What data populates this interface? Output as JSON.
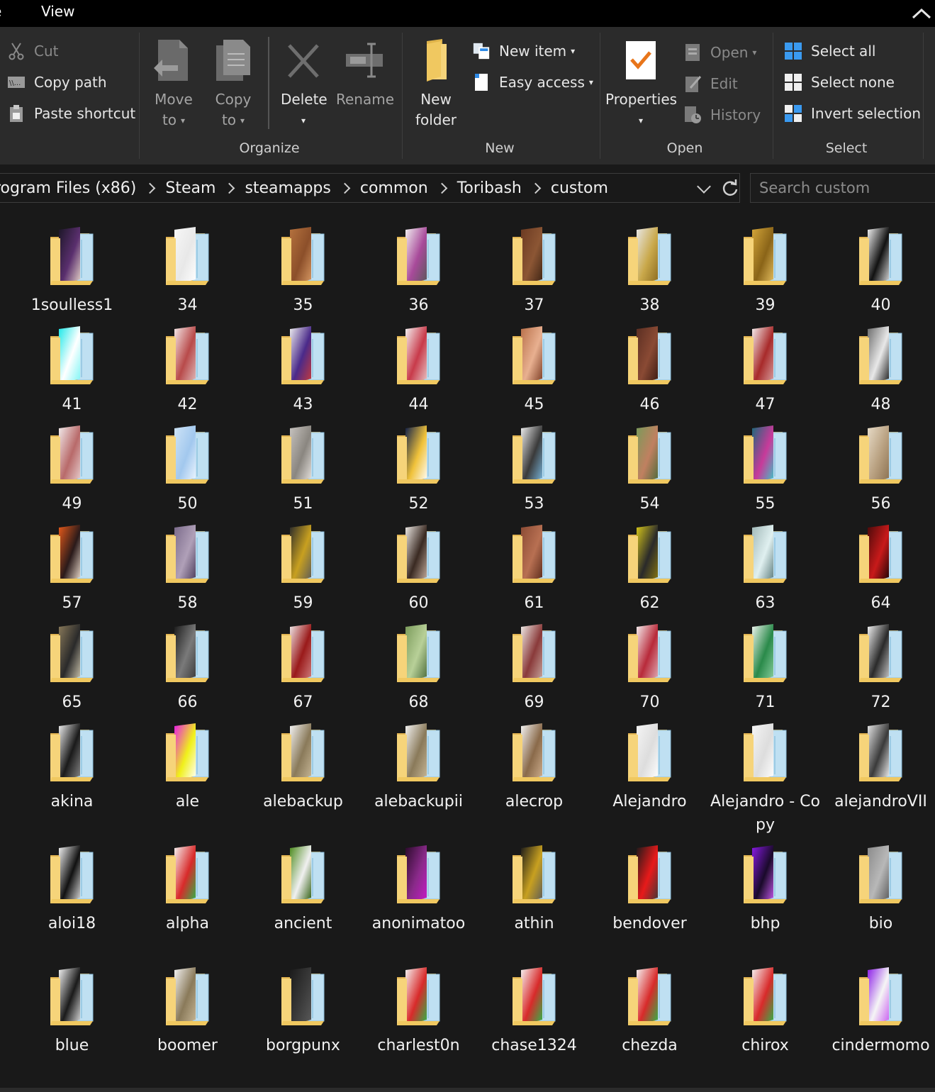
{
  "tabs": {
    "file": "e",
    "view": "View"
  },
  "ribbon": {
    "clipboard": {
      "cut": "Cut",
      "copy_path": "Copy path",
      "paste_shortcut": "Paste shortcut"
    },
    "organize": {
      "title": "Organize",
      "move_to_1": "Move",
      "move_to_2": "to",
      "copy_to_1": "Copy",
      "copy_to_2": "to",
      "delete": "Delete",
      "rename": "Rename"
    },
    "new": {
      "title": "New",
      "new_folder_1": "New",
      "new_folder_2": "folder",
      "new_item": "New item",
      "easy_access": "Easy access"
    },
    "open": {
      "title": "Open",
      "properties": "Properties",
      "open": "Open",
      "edit": "Edit",
      "history": "History"
    },
    "select": {
      "title": "Select",
      "select_all": "Select all",
      "select_none": "Select none",
      "invert_selection": "Invert selection"
    }
  },
  "address": {
    "breadcrumbs": [
      "rogram Files (x86)",
      "Steam",
      "steamapps",
      "common",
      "Toribash",
      "custom"
    ]
  },
  "search": {
    "placeholder": "Search custom"
  },
  "folders": [
    {
      "name": "1soulless1",
      "thumb": [
        "#1b1626",
        "#5a2f6e",
        "#e7d4c8"
      ]
    },
    {
      "name": "34",
      "thumb": [
        "#f7f7f7",
        "#e8e8e8",
        "#ffffff"
      ]
    },
    {
      "name": "35",
      "thumb": [
        "#b5723e",
        "#8c4f2a",
        "#d89a64"
      ]
    },
    {
      "name": "36",
      "thumb": [
        "#f2f2f2",
        "#a84a9a",
        "#5a5a5a"
      ]
    },
    {
      "name": "37",
      "thumb": [
        "#6b3a22",
        "#8c5634",
        "#3d2314"
      ]
    },
    {
      "name": "38",
      "thumb": [
        "#e8e8e8",
        "#c9a84a",
        "#8a6a1e"
      ]
    },
    {
      "name": "39",
      "thumb": [
        "#d4a63a",
        "#8a6418",
        "#e6c060"
      ]
    },
    {
      "name": "40",
      "thumb": [
        "#f5f5f5",
        "#111111",
        "#dddddd"
      ]
    },
    {
      "name": "41",
      "thumb": [
        "#19e8e8",
        "#ffffff",
        "#7af5f5"
      ]
    },
    {
      "name": "42",
      "thumb": [
        "#f5eaea",
        "#b84a4a",
        "#e0bcbc"
      ]
    },
    {
      "name": "43",
      "thumb": [
        "#f0f0f0",
        "#4a2a8a",
        "#c83a3a"
      ]
    },
    {
      "name": "44",
      "thumb": [
        "#f5f5f5",
        "#c83a4a",
        "#e8c8c8"
      ]
    },
    {
      "name": "45",
      "thumb": [
        "#b8704a",
        "#e8b090",
        "#7a3a22"
      ]
    },
    {
      "name": "46",
      "thumb": [
        "#5a2e22",
        "#8a4a34",
        "#3a1a12"
      ]
    },
    {
      "name": "47",
      "thumb": [
        "#f5f0f0",
        "#a82a2a",
        "#d8a0a0"
      ]
    },
    {
      "name": "48",
      "thumb": [
        "#6a6a6a",
        "#e8e8e8",
        "#1a1a1a"
      ]
    },
    {
      "name": "49",
      "thumb": [
        "#f2ecec",
        "#b86a6a",
        "#e8d0d0"
      ]
    },
    {
      "name": "50",
      "thumb": [
        "#cfe4f7",
        "#a2c8ee",
        "#f0f7ff"
      ]
    },
    {
      "name": "51",
      "thumb": [
        "#c8c4c0",
        "#8a8680",
        "#e8e4e0"
      ]
    },
    {
      "name": "52",
      "thumb": [
        "#0e1e4a",
        "#f0c23a",
        "#ffffff"
      ]
    },
    {
      "name": "53",
      "thumb": [
        "#f0f0f0",
        "#3a3a3a",
        "#7ab8e0"
      ]
    },
    {
      "name": "54",
      "thumb": [
        "#7a9a5a",
        "#c08060",
        "#4a6a3a"
      ]
    },
    {
      "name": "55",
      "thumb": [
        "#1a6a7a",
        "#c83a9a",
        "#3ac8c8"
      ]
    },
    {
      "name": "56",
      "thumb": [
        "#e8dcc8",
        "#b8a080",
        "#8a7050"
      ]
    },
    {
      "name": "57",
      "thumb": [
        "#e85a1a",
        "#2a1a1a",
        "#f0e0d0"
      ]
    },
    {
      "name": "58",
      "thumb": [
        "#7a6a8a",
        "#b0a0b8",
        "#4a3a5a"
      ]
    },
    {
      "name": "59",
      "thumb": [
        "#2a2a2a",
        "#c8a020",
        "#5a5a5a"
      ]
    },
    {
      "name": "60",
      "thumb": [
        "#f0ece8",
        "#3a2a22",
        "#c8b0a0"
      ]
    },
    {
      "name": "61",
      "thumb": [
        "#8a4a34",
        "#b87052",
        "#5a2a1a"
      ]
    },
    {
      "name": "62",
      "thumb": [
        "#d8c81a",
        "#2a2a2a",
        "#8a7a10"
      ]
    },
    {
      "name": "63",
      "thumb": [
        "#a0b8b8",
        "#e0f0f0",
        "#5a7a7a"
      ]
    },
    {
      "name": "64",
      "thumb": [
        "#4a0a0a",
        "#c81a1a",
        "#1a0404"
      ]
    },
    {
      "name": "65",
      "thumb": [
        "#8a7a5a",
        "#2a2a2a",
        "#d0c8b0"
      ]
    },
    {
      "name": "66",
      "thumb": [
        "#1a1a1a",
        "#7a7a7a",
        "#3a3a3a"
      ]
    },
    {
      "name": "67",
      "thumb": [
        "#f0e8e8",
        "#9a1a1a",
        "#d08080"
      ]
    },
    {
      "name": "68",
      "thumb": [
        "#7a9a5a",
        "#b8d098",
        "#4a6a3a"
      ]
    },
    {
      "name": "69",
      "thumb": [
        "#f0ece8",
        "#8a3a3a",
        "#c8a8a0"
      ]
    },
    {
      "name": "70",
      "thumb": [
        "#f5f0f0",
        "#b82a3a",
        "#e0b0b8"
      ]
    },
    {
      "name": "71",
      "thumb": [
        "#f0f5f0",
        "#2a8a4a",
        "#8ad0a0"
      ]
    },
    {
      "name": "72",
      "thumb": [
        "#f5f5f5",
        "#2a2a2a",
        "#cccccc"
      ]
    },
    {
      "name": "akina",
      "thumb": [
        "#f0f0f0",
        "#1a1a1a",
        "#8a8a8a"
      ]
    },
    {
      "name": "ale",
      "thumb": [
        "#e81ae8",
        "#f0f01a",
        "#ffffff"
      ]
    },
    {
      "name": "alebackup",
      "thumb": [
        "#f5f5f5",
        "#8a7a5a",
        "#c8b898"
      ]
    },
    {
      "name": "alebackupii",
      "thumb": [
        "#f5f5f5",
        "#8a7a5a",
        "#c8b898"
      ]
    },
    {
      "name": "alecrop",
      "thumb": [
        "#f5f5f5",
        "#8a6a4a",
        "#d0b090"
      ]
    },
    {
      "name": "Alejandro",
      "thumb": [
        "#f5f5f5",
        "#dddddd",
        "#ffffff"
      ]
    },
    {
      "name": "Alejandro - Copy",
      "thumb": [
        "#f5f5f5",
        "#dddddd",
        "#ffffff"
      ]
    },
    {
      "name": "alejandroVII",
      "thumb": [
        "#e8e8e8",
        "#3a3a3a",
        "#f5f5f5"
      ]
    },
    {
      "name": "aloi18",
      "thumb": [
        "#f5f5f5",
        "#111111",
        "#dddddd"
      ]
    },
    {
      "name": "alpha",
      "thumb": [
        "#f5f5f5",
        "#d82a2a",
        "#2ab84a"
      ]
    },
    {
      "name": "ancient",
      "thumb": [
        "#4a8a1a",
        "#f0f0f0",
        "#2a5a0a"
      ]
    },
    {
      "name": "anonimatoo",
      "thumb": [
        "#2a0a2a",
        "#8a2a8a",
        "#c81ac8"
      ]
    },
    {
      "name": "athin",
      "thumb": [
        "#1a1a1a",
        "#c8a020",
        "#5a5a5a"
      ]
    },
    {
      "name": "bendover",
      "thumb": [
        "#1a1a1a",
        "#e81a1a",
        "#3a3a3a"
      ]
    },
    {
      "name": "bhp",
      "thumb": [
        "#8a1ae8",
        "#1a0a2a",
        "#c85af0"
      ]
    },
    {
      "name": "bio",
      "thumb": [
        "#8a8a8a",
        "#b8b8b8",
        "#5a5a5a"
      ]
    },
    {
      "name": "blue",
      "thumb": [
        "#f5f5f5",
        "#1a1a1a",
        "#dddddd"
      ]
    },
    {
      "name": "boomer",
      "thumb": [
        "#f5f5f5",
        "#8a7a5a",
        "#c8b898"
      ]
    },
    {
      "name": "borgpunx",
      "thumb": [
        "#1a1a1a",
        "#3a3a3a",
        "#5a5a5a"
      ]
    },
    {
      "name": "charlest0n",
      "thumb": [
        "#f5f5f5",
        "#d82a2a",
        "#2ab84a"
      ]
    },
    {
      "name": "chase1324",
      "thumb": [
        "#f5f5f5",
        "#d82a2a",
        "#2ab84a"
      ]
    },
    {
      "name": "chezda",
      "thumb": [
        "#f5f5f5",
        "#d82a2a",
        "#2ab84a"
      ]
    },
    {
      "name": "chirox",
      "thumb": [
        "#f5f5f5",
        "#d82a2a",
        "#2ab84a"
      ]
    },
    {
      "name": "cindermomo",
      "thumb": [
        "#8a1ae8",
        "#f5f5f5",
        "#c85af0"
      ]
    }
  ],
  "colors": {
    "background": "#191919",
    "ribbon": "#2b2b2b",
    "titlebar": "#000000",
    "accent_blue": "#2e8ae6",
    "folder_yellow": "#f6d47a"
  }
}
